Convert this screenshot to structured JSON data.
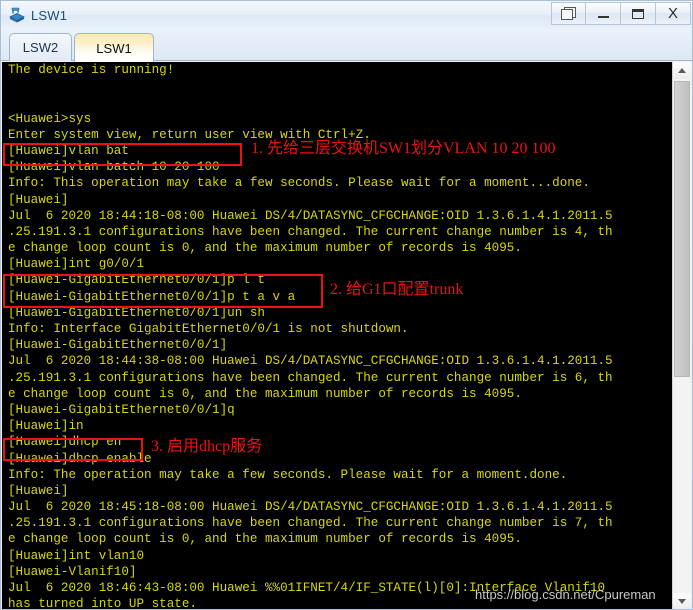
{
  "window": {
    "title": "LSW1",
    "icon": "switch-icon",
    "controls": [
      {
        "name": "restore-button",
        "label": "❐",
        "glyph": "restore"
      },
      {
        "name": "minimize-button",
        "label": "–",
        "glyph": "minimize"
      },
      {
        "name": "maximize-button",
        "label": "□",
        "glyph": "maximize"
      },
      {
        "name": "close-button",
        "label": "X",
        "glyph": "close"
      }
    ]
  },
  "tabs": [
    {
      "label": "LSW2",
      "active": false
    },
    {
      "label": "LSW1",
      "active": true
    }
  ],
  "terminal": {
    "foreground_color": "#d7d70b",
    "background_color": "#000000",
    "lines": [
      "The device is running!",
      "",
      "",
      "<Huawei>sys",
      "Enter system view, return user view with Ctrl+Z.",
      "[Huawei]vlan bat",
      "[Huawei]vlan batch 10 20 100",
      "Info: This operation may take a few seconds. Please wait for a moment...done.",
      "[Huawei]",
      "Jul  6 2020 18:44:18-08:00 Huawei DS/4/DATASYNC_CFGCHANGE:OID 1.3.6.1.4.1.2011.5",
      ".25.191.3.1 configurations have been changed. The current change number is 4, th",
      "e change loop count is 0, and the maximum number of records is 4095.",
      "[Huawei]int g0/0/1",
      "[Huawei-GigabitEthernet0/0/1]p l t",
      "[Huawei-GigabitEthernet0/0/1]p t a v a",
      "[Huawei-GigabitEthernet0/0/1]un sh",
      "Info: Interface GigabitEthernet0/0/1 is not shutdown.",
      "[Huawei-GigabitEthernet0/0/1]",
      "Jul  6 2020 18:44:38-08:00 Huawei DS/4/DATASYNC_CFGCHANGE:OID 1.3.6.1.4.1.2011.5",
      ".25.191.3.1 configurations have been changed. The current change number is 6, th",
      "e change loop count is 0, and the maximum number of records is 4095.",
      "[Huawei-GigabitEthernet0/0/1]q",
      "[Huawei]in",
      "[Huawei]dhcp en",
      "[Huawei]dhcp enable",
      "Info: The operation may take a few seconds. Please wait for a moment.done.",
      "[Huawei]",
      "Jul  6 2020 18:45:18-08:00 Huawei DS/4/DATASYNC_CFGCHANGE:OID 1.3.6.1.4.1.2011.5",
      ".25.191.3.1 configurations have been changed. The current change number is 7, th",
      "e change loop count is 0, and the maximum number of records is 4095.",
      "[Huawei]int vlan10",
      "[Huawei-Vlanif10]",
      "Jul  6 2020 18:46:43-08:00 Huawei %%01IFNET/4/IF_STATE(l)[0]:Interface Vlanif10",
      "has turned into UP state."
    ]
  },
  "annotations": [
    {
      "name": "annotation-1",
      "label": "1. 先给三层交换机SW1划分VLAN  10  20  100",
      "color": "#ee1111"
    },
    {
      "name": "annotation-2",
      "label": "2. 给G1口配置trunk",
      "color": "#ee1111"
    },
    {
      "name": "annotation-3",
      "label": "3. 启用dhcp服务",
      "color": "#ee1111"
    }
  ],
  "scrollbar": {
    "up_arrow": "chevron-up-icon",
    "down_arrow": "chevron-down-icon"
  },
  "watermark": "https://blog.csdn.net/Cpureman"
}
